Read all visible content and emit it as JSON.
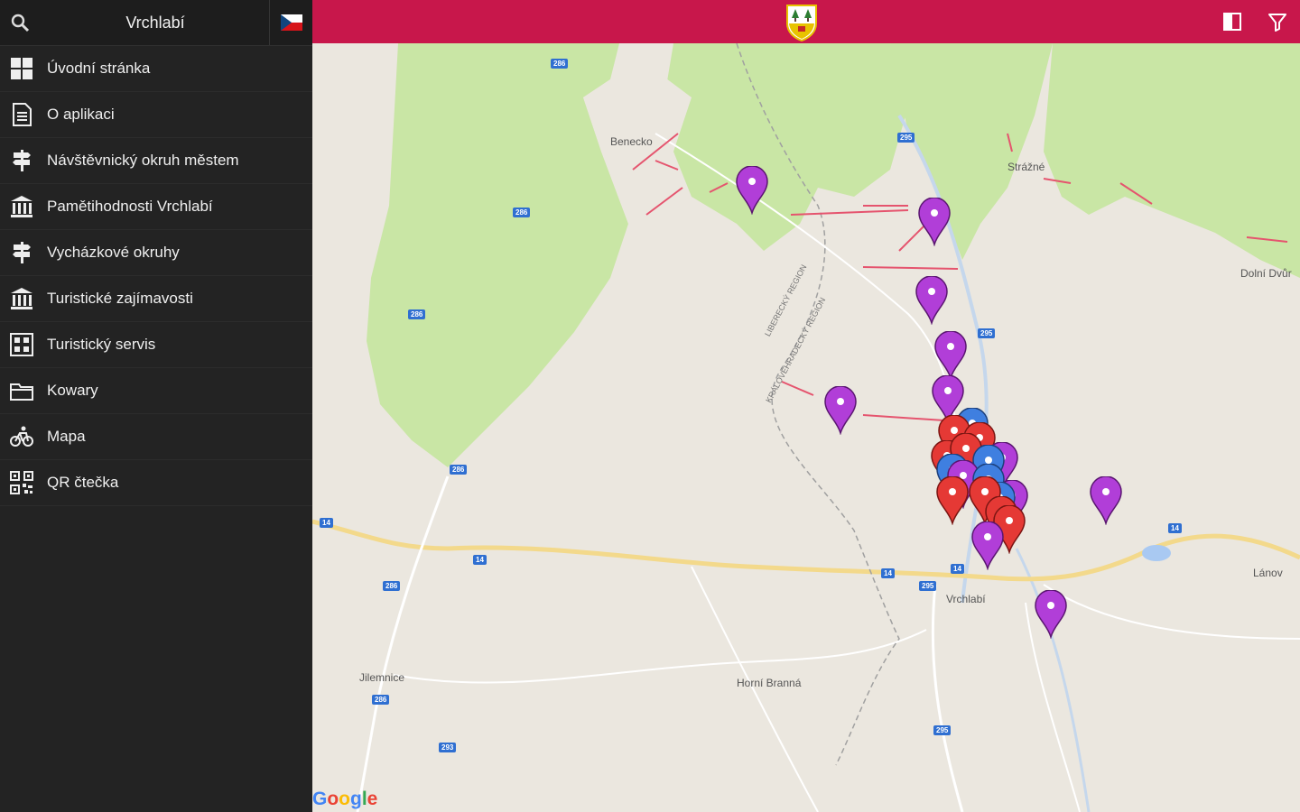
{
  "sidebar": {
    "title": "Vrchlabí",
    "menu": [
      {
        "label": "Úvodní stránka",
        "icon": "grid-icon"
      },
      {
        "label": "O aplikaci",
        "icon": "document-icon"
      },
      {
        "label": "Návštěvnický okruh městem",
        "icon": "signpost-icon"
      },
      {
        "label": "Pamětihodnosti Vrchlabí",
        "icon": "building-icon"
      },
      {
        "label": "Vycházkové okruhy",
        "icon": "signpost-icon"
      },
      {
        "label": "Turistické zajímavosti",
        "icon": "building-icon"
      },
      {
        "label": "Turistický servis",
        "icon": "service-icon"
      },
      {
        "label": "Kowary",
        "icon": "folder-icon"
      },
      {
        "label": "Mapa",
        "icon": "bicycle-icon"
      },
      {
        "label": "QR čtečka",
        "icon": "qr-icon"
      }
    ]
  },
  "map": {
    "places": [
      {
        "name": "Benecko"
      },
      {
        "name": "Strážné"
      },
      {
        "name": "Dolní Dvůr"
      },
      {
        "name": "Vrchlabí"
      },
      {
        "name": "Jilemnice"
      },
      {
        "name": "Horní Branná"
      },
      {
        "name": "Lánov"
      }
    ],
    "road_labels": [
      "286",
      "295",
      "286",
      "286",
      "286",
      "286",
      "295",
      "14",
      "14",
      "14",
      "14",
      "14",
      "295",
      "286",
      "293",
      "295"
    ],
    "region_labels": [
      "LIBERECKÝ REGION",
      "KRÁLOVÉHRADECKÝ REGION"
    ],
    "attribution": [
      "G",
      "o",
      "o",
      "g",
      "l",
      "e"
    ]
  },
  "colors": {
    "topbar": "#c8174b",
    "sidebar": "#232323",
    "marker_purple": "#b13ed8",
    "marker_red": "#e53935",
    "marker_blue": "#3f7fe0",
    "forest": "#c9e6a5",
    "map_bg": "#ebe7df"
  }
}
